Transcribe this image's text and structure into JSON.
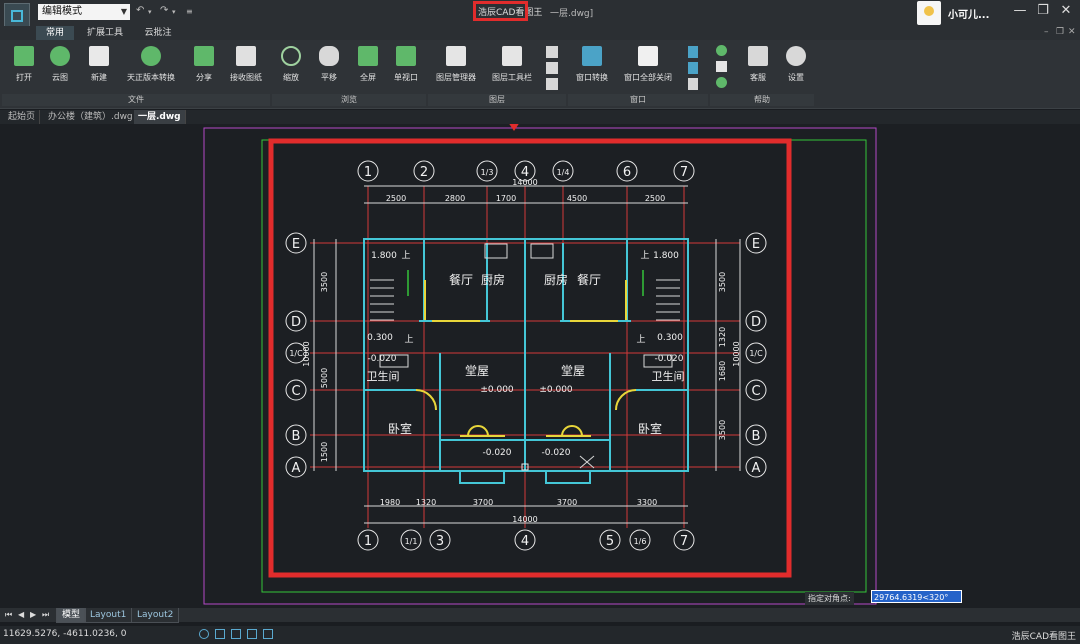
{
  "titlebar": {
    "mode": "编辑模式",
    "app_title": "浩辰CAD看图王",
    "file_title": "一层.dwg]",
    "user": "小可儿..."
  },
  "ribbon_tabs": [
    "常用",
    "扩展工具",
    "云批注"
  ],
  "ribbon": {
    "buttons": [
      "打开",
      "云图",
      "新建",
      "天正版本转换",
      "分享",
      "接收图纸",
      "缩放",
      "平移",
      "全屏",
      "单视口",
      "图层管理器",
      "图层工具栏",
      "窗口转换",
      "窗口全部关闭",
      "客服",
      "设置"
    ],
    "groups": [
      "文件",
      "浏览",
      "图层",
      "窗口",
      "帮助"
    ]
  },
  "doc_tabs": [
    "起始页",
    "办公楼（建筑）.dwg",
    "一层.dwg"
  ],
  "layout_tabs": [
    "模型",
    "Layout1",
    "Layout2"
  ],
  "command": {
    "label": "指定对角点:",
    "value": "29764.6319<320°"
  },
  "status": {
    "coords": "11629.5276, -4611.0236, 0",
    "app": "浩辰CAD看图王"
  },
  "drawing": {
    "axes_top": [
      "1",
      "2",
      "1/3",
      "4",
      "1/4",
      "6",
      "7"
    ],
    "axes_bottom": [
      "1",
      "1/1",
      "3",
      "4",
      "5",
      "1/6",
      "7"
    ],
    "axes_side": [
      "E",
      "D",
      "1/C",
      "C",
      "B",
      "A"
    ],
    "dims_top": [
      "2500",
      "2800",
      "1700",
      "4500",
      "2500"
    ],
    "total_dim": "14000",
    "dims_bottom": [
      "1980",
      "1320",
      "3700",
      "3700",
      "3300"
    ],
    "dims_left": [
      "3500",
      "10000",
      "5000",
      "1500"
    ],
    "dims_right": [
      "3500",
      "1320",
      "10000",
      "1680",
      "3500"
    ],
    "rooms": {
      "dining": "餐厅",
      "kitchen": "厨房",
      "hall": "堂屋",
      "bath": "卫生间",
      "bedroom": "卧室"
    },
    "levels": {
      "stair": "1.800",
      "up": "上",
      "landing": "0.300",
      "bath": "-0.020",
      "hall": "±0.000",
      "door": "-0.020"
    }
  }
}
